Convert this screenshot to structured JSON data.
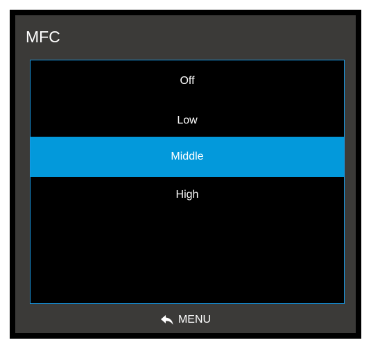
{
  "menu": {
    "title": "MFC",
    "options": [
      {
        "label": "Off",
        "selected": false
      },
      {
        "label": "Low",
        "selected": false
      },
      {
        "label": "Middle",
        "selected": true
      },
      {
        "label": "High",
        "selected": false
      }
    ]
  },
  "footer": {
    "icon": "back-arrow-icon",
    "label": "MENU"
  },
  "colors": {
    "accent": "#0399db",
    "border": "#1a9be6",
    "panel": "#3b3a38"
  }
}
